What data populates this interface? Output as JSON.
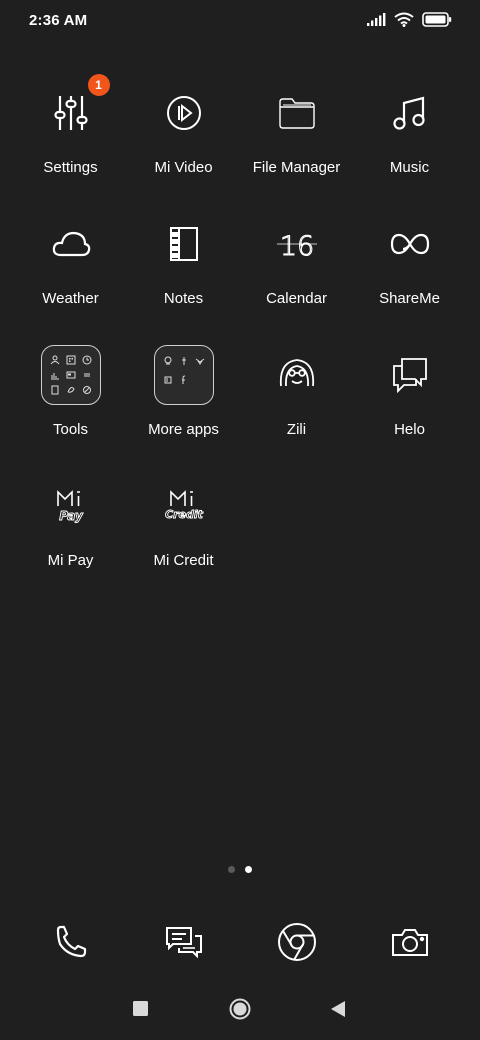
{
  "status_bar": {
    "time": "2:36 AM",
    "icons": [
      "signal-icon",
      "wifi-icon",
      "battery-icon"
    ]
  },
  "apps": [
    {
      "label": "Settings",
      "icon": "sliders-icon",
      "badge": "1"
    },
    {
      "label": "Mi Video",
      "icon": "play-circle-icon"
    },
    {
      "label": "File Manager",
      "icon": "folder-icon"
    },
    {
      "label": "Music",
      "icon": "music-note-icon"
    },
    {
      "label": "Weather",
      "icon": "cloud-icon"
    },
    {
      "label": "Notes",
      "icon": "notebook-icon"
    },
    {
      "label": "Calendar",
      "icon": "calendar-16-icon",
      "icon_text": "16"
    },
    {
      "label": "ShareMe",
      "icon": "infinity-icon"
    },
    {
      "label": "Tools",
      "icon": "folder-grid-icon"
    },
    {
      "label": "More apps",
      "icon": "folder-grid-icon"
    },
    {
      "label": "Zili",
      "icon": "zili-face-icon"
    },
    {
      "label": "Helo",
      "icon": "chat-bubbles-icon"
    },
    {
      "label": "Mi Pay",
      "icon": "mi-pay-logo-icon",
      "icon_text": "Pay"
    },
    {
      "label": "Mi Credit",
      "icon": "mi-credit-logo-icon",
      "icon_text": "Credit"
    }
  ],
  "page_indicator": {
    "count": 2,
    "active_index": 1
  },
  "dock": [
    {
      "icon": "phone-icon"
    },
    {
      "icon": "messages-icon"
    },
    {
      "icon": "chrome-browser-icon"
    },
    {
      "icon": "camera-icon"
    }
  ],
  "nav": [
    "recents-square-icon",
    "home-circle-icon",
    "back-triangle-icon"
  ],
  "colors": {
    "background": "#1f1f1f",
    "badge": "#f0561b",
    "foreground": "#ffffff"
  }
}
